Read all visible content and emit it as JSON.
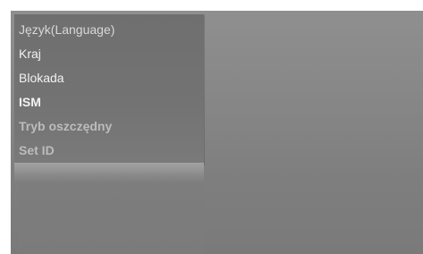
{
  "menu": {
    "items": [
      {
        "label": "Język(Language)"
      },
      {
        "label": "Kraj"
      },
      {
        "label": "Blokada"
      },
      {
        "label": "ISM"
      },
      {
        "label": "Tryb oszczędny"
      },
      {
        "label": "Set ID"
      }
    ]
  }
}
